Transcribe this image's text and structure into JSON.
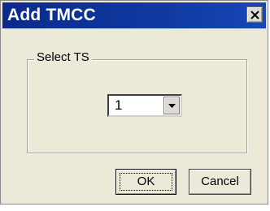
{
  "window": {
    "title": "Add TMCC"
  },
  "group": {
    "label": "Select TS"
  },
  "select": {
    "value": "1"
  },
  "buttons": {
    "ok": "OK",
    "cancel": "Cancel"
  },
  "icons": {
    "close": "close-icon",
    "dropdown": "chevron-down-icon"
  }
}
